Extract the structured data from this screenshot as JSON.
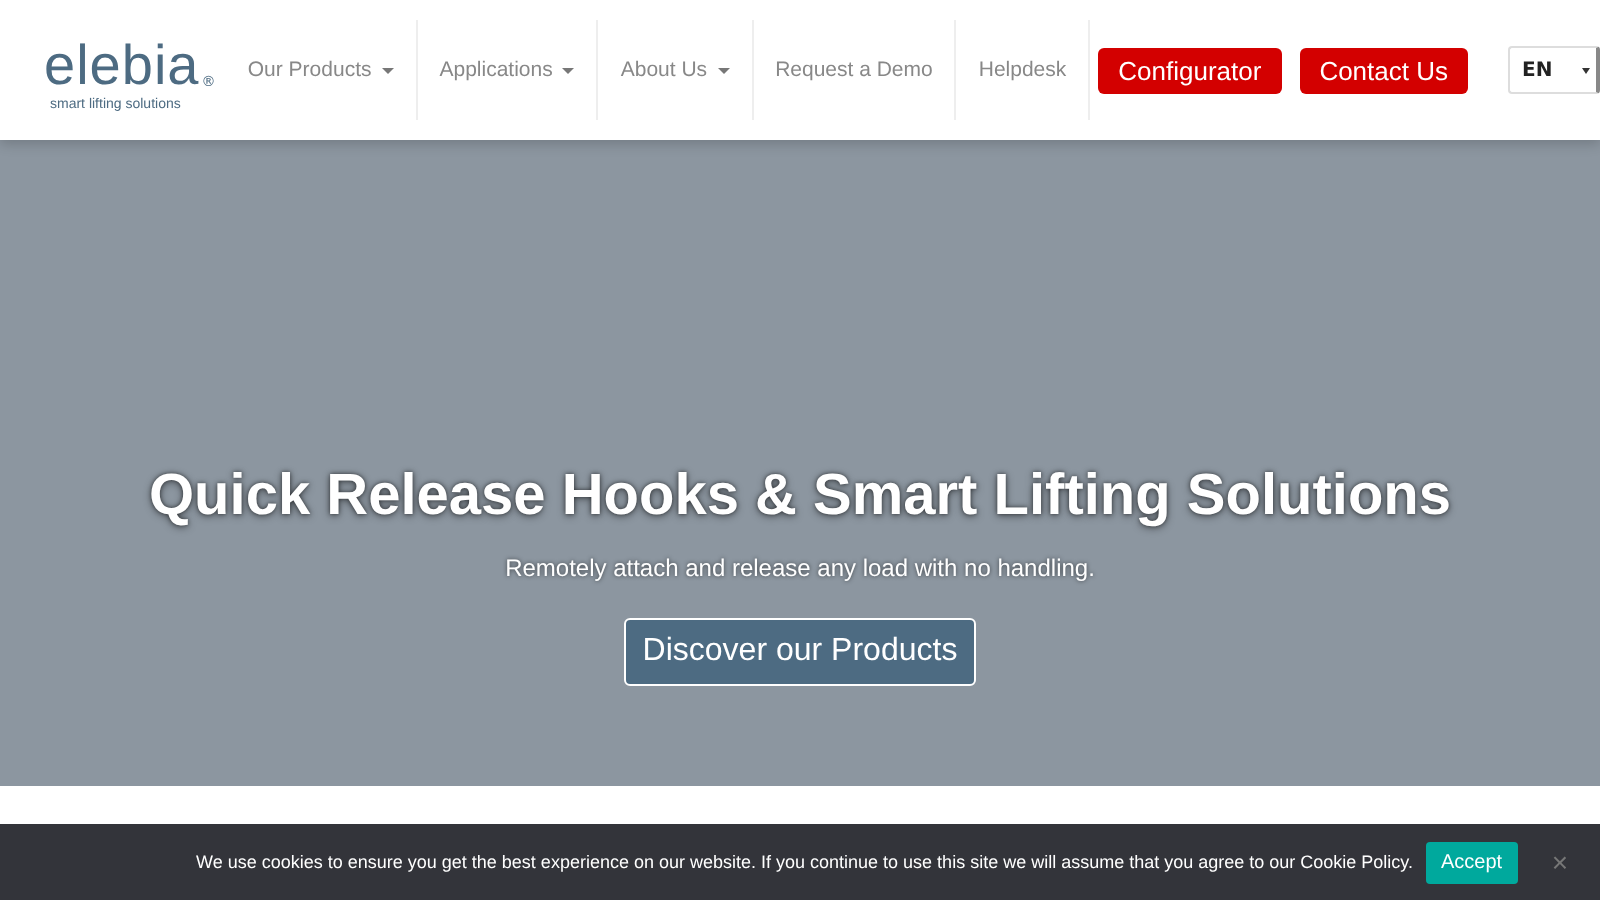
{
  "logo": {
    "name": "elebia",
    "registered": "®",
    "tagline": "smart lifting solutions"
  },
  "nav": [
    {
      "kind": "link",
      "label": "Our Products",
      "dropdown": true
    },
    {
      "kind": "link",
      "label": "Applications",
      "dropdown": true
    },
    {
      "kind": "link",
      "label": "About Us",
      "dropdown": true
    },
    {
      "kind": "link",
      "label": "Request a Demo",
      "dropdown": false
    },
    {
      "kind": "link",
      "label": "Helpdesk",
      "dropdown": false
    },
    {
      "kind": "button",
      "label": "Configurator"
    },
    {
      "kind": "button",
      "label": "Contact Us"
    }
  ],
  "language": {
    "value": "EN"
  },
  "hero": {
    "title": "Quick Release Hooks & Smart Lifting Solutions",
    "subtitle": "Remotely attach and release any load with no handling.",
    "button": "Discover our Products"
  },
  "cookie_bar": {
    "text": "We use cookies to ensure you get the best experience on our website. If you continue to use this site we will assume that you agree to our Cookie Policy.",
    "accept": "Accept",
    "close": "×"
  }
}
